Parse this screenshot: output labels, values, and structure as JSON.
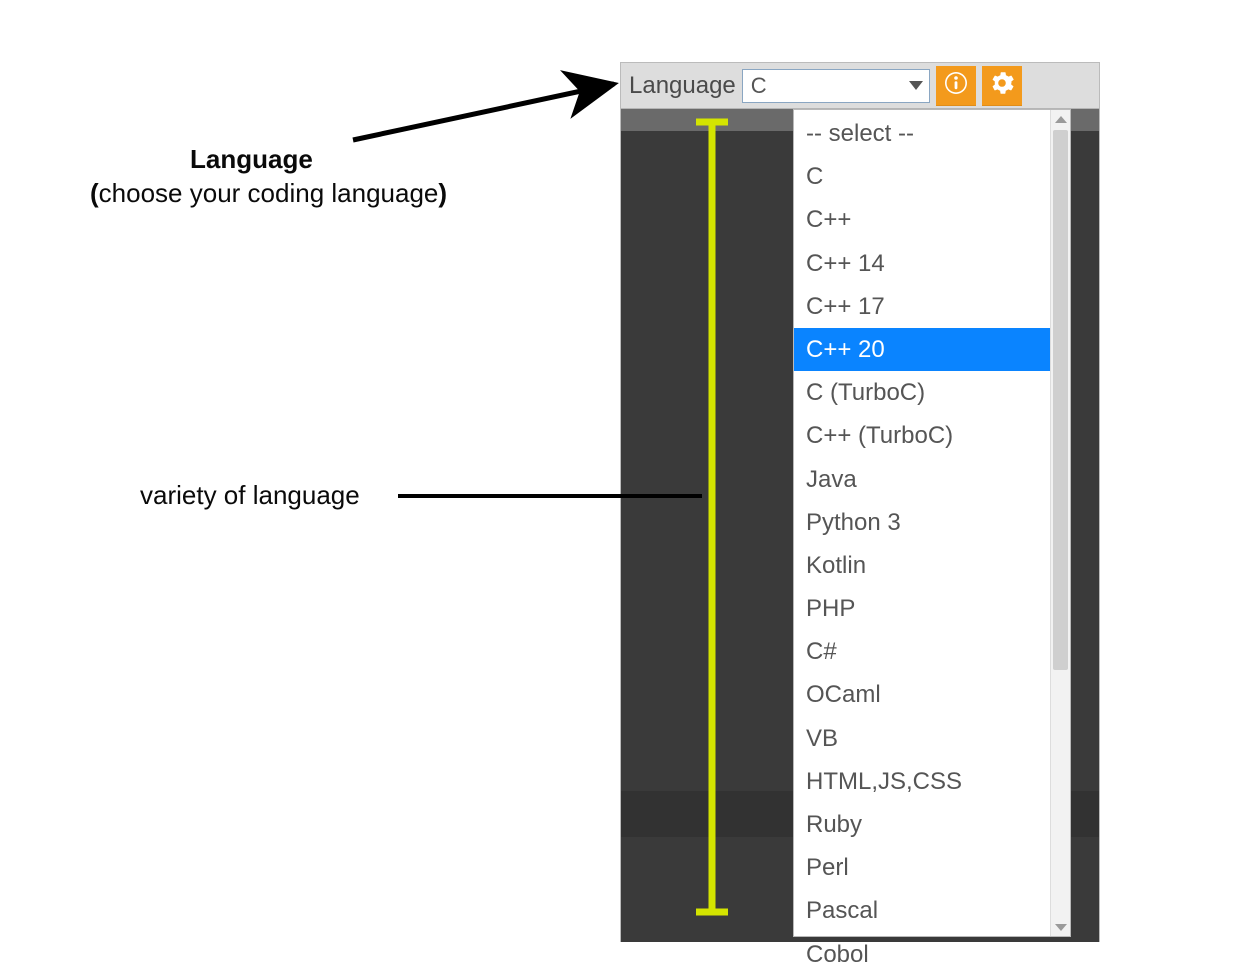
{
  "annotations": {
    "title": "Language",
    "subtitle_inner": "choose your coding language",
    "variety": "variety of  language"
  },
  "toolbar": {
    "label": "Language",
    "selected": "C"
  },
  "dropdown": {
    "options": [
      "-- select --",
      "C",
      "C++",
      "C++ 14",
      "C++ 17",
      "C++ 20",
      "C (TurboC)",
      "C++ (TurboC)",
      "Java",
      "Python 3",
      "Kotlin",
      "PHP",
      "C#",
      "OCaml",
      "VB",
      "HTML,JS,CSS",
      "Ruby",
      "Perl",
      "Pascal",
      "Cobol"
    ],
    "highlighted": "C++ 20"
  },
  "icons": {
    "info": "info-icon",
    "gear": "gear-icon"
  }
}
